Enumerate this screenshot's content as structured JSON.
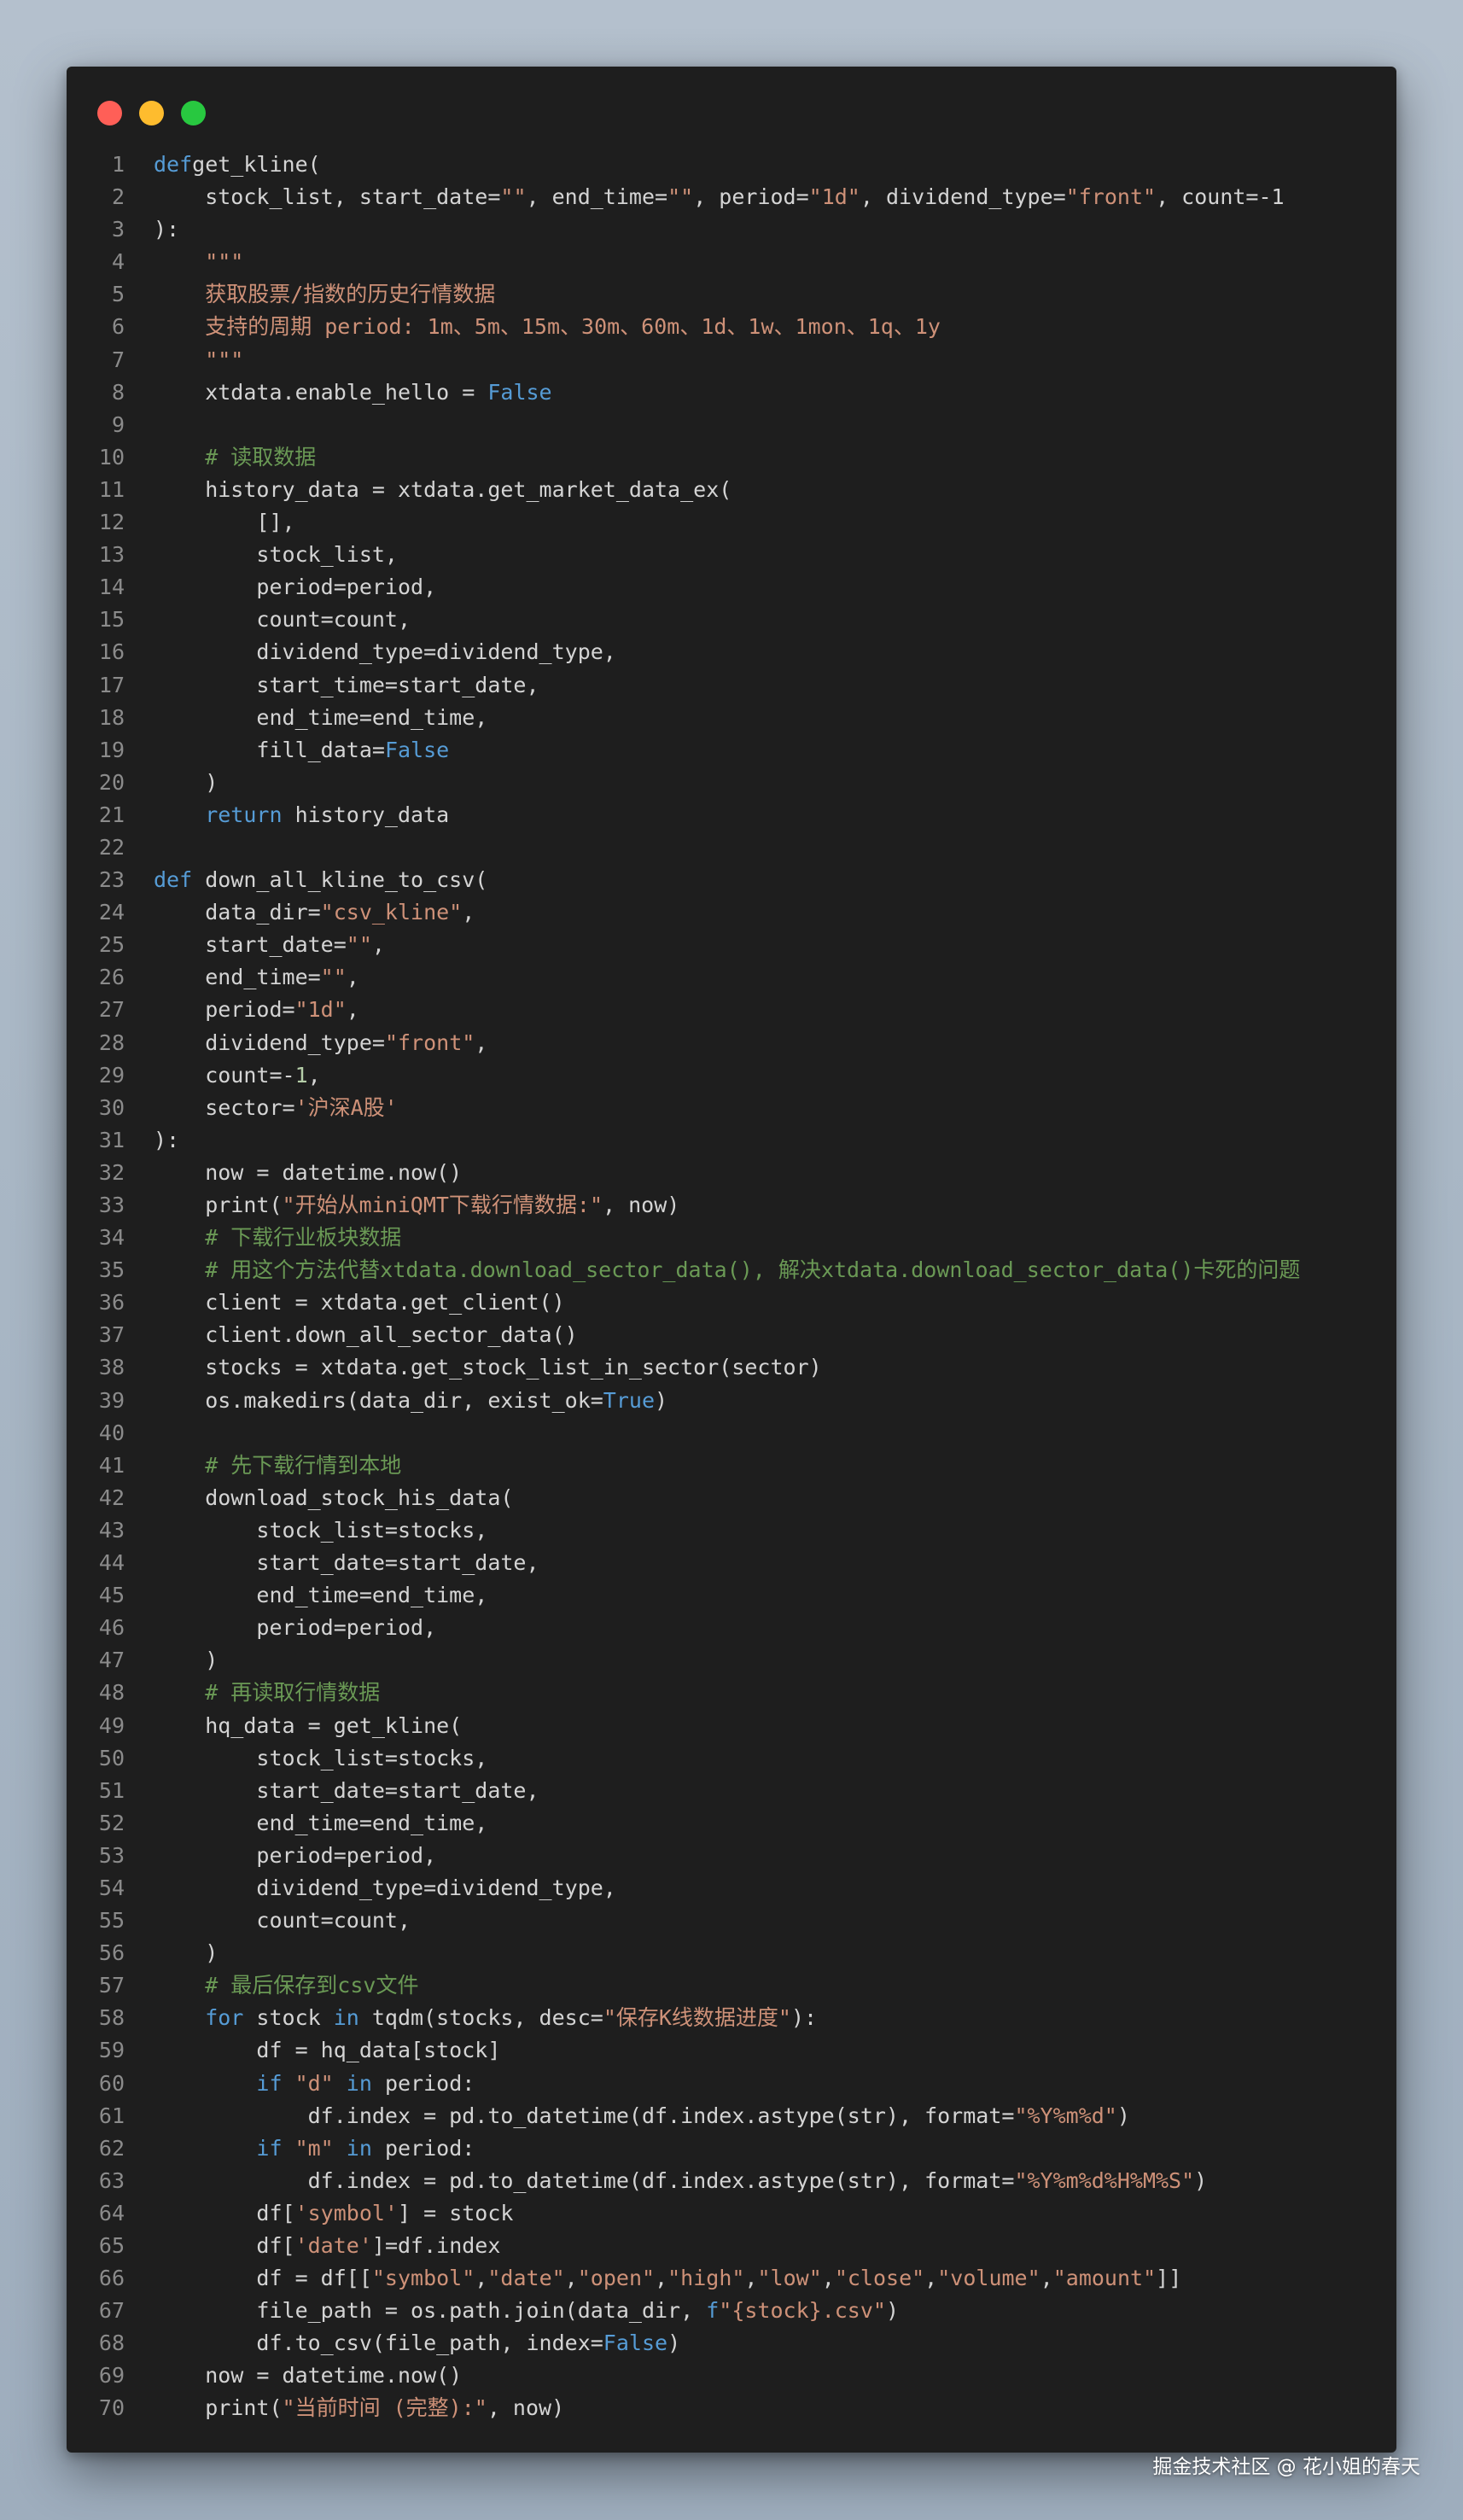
{
  "window": {
    "title_dots": [
      "close",
      "minimize",
      "zoom"
    ]
  },
  "colors": {
    "keyword": "#569cd6",
    "string": "#ce9178",
    "comment": "#6a9955",
    "number": "#b5cea8",
    "text": "#d4d4d4",
    "background": "#1e1e1e"
  },
  "code_lines": [
    [
      [
        "kw",
        "def"
      ],
      [
        "",
        "get_kline("
      ]
    ],
    [
      [
        "",
        "    stock_list, start_date="
      ],
      [
        "str",
        "\"\""
      ],
      [
        "",
        ", end_time="
      ],
      [
        "str",
        "\"\""
      ],
      [
        "",
        ", period="
      ],
      [
        "str",
        "\"1d\""
      ],
      [
        "",
        ", dividend_type="
      ],
      [
        "str",
        "\"front\""
      ],
      [
        "",
        ", count=-1"
      ]
    ],
    [
      [
        "",
        "):"
      ]
    ],
    [
      [
        "str",
        "    \"\"\""
      ]
    ],
    [
      [
        "str",
        "    获取股票/指数的历史行情数据"
      ]
    ],
    [
      [
        "str",
        "    支持的周期 period: 1m、5m、15m、30m、60m、1d、1w、1mon、1q、1y"
      ]
    ],
    [
      [
        "str",
        "    \"\"\""
      ]
    ],
    [
      [
        "",
        "    xtdata.enable_hello = "
      ],
      [
        "kw",
        "False"
      ]
    ],
    [
      [
        "",
        ""
      ]
    ],
    [
      [
        "cm",
        "    # 读取数据"
      ]
    ],
    [
      [
        "",
        "    history_data = xtdata.get_market_data_ex("
      ]
    ],
    [
      [
        "",
        "        [],"
      ]
    ],
    [
      [
        "",
        "        stock_list,"
      ]
    ],
    [
      [
        "",
        "        period=period,"
      ]
    ],
    [
      [
        "",
        "        count=count,"
      ]
    ],
    [
      [
        "",
        "        dividend_type=dividend_type,"
      ]
    ],
    [
      [
        "",
        "        start_time=start_date,"
      ]
    ],
    [
      [
        "",
        "        end_time=end_time,"
      ]
    ],
    [
      [
        "",
        "        fill_data="
      ],
      [
        "kw",
        "False"
      ]
    ],
    [
      [
        "",
        "    )"
      ]
    ],
    [
      [
        "kw",
        "    return"
      ],
      [
        "",
        " history_data"
      ]
    ],
    [
      [
        "",
        ""
      ]
    ],
    [
      [
        "kw",
        "def"
      ],
      [
        "",
        " down_all_kline_to_csv("
      ]
    ],
    [
      [
        "",
        "    data_dir="
      ],
      [
        "str",
        "\"csv_kline\""
      ],
      [
        "",
        ","
      ]
    ],
    [
      [
        "",
        "    start_date="
      ],
      [
        "str",
        "\"\""
      ],
      [
        "",
        ","
      ]
    ],
    [
      [
        "",
        "    end_time="
      ],
      [
        "str",
        "\"\""
      ],
      [
        "",
        ","
      ]
    ],
    [
      [
        "",
        "    period="
      ],
      [
        "str",
        "\"1d\""
      ],
      [
        "",
        ","
      ]
    ],
    [
      [
        "",
        "    dividend_type="
      ],
      [
        "str",
        "\"front\""
      ],
      [
        "",
        ","
      ]
    ],
    [
      [
        "",
        "    count=-"
      ],
      [
        "num",
        "1"
      ],
      [
        "",
        ","
      ]
    ],
    [
      [
        "",
        "    sector="
      ],
      [
        "str",
        "'沪深A股'"
      ]
    ],
    [
      [
        "",
        "):"
      ]
    ],
    [
      [
        "",
        "    now = datetime.now()"
      ]
    ],
    [
      [
        "",
        "    print("
      ],
      [
        "str",
        "\"开始从miniQMT下载行情数据:\""
      ],
      [
        "",
        ", now)"
      ]
    ],
    [
      [
        "cm",
        "    # 下载行业板块数据"
      ]
    ],
    [
      [
        "cm",
        "    # 用这个方法代替xtdata.download_sector_data(), 解决xtdata.download_sector_data()卡死的问题"
      ]
    ],
    [
      [
        "",
        "    client = xtdata.get_client()"
      ]
    ],
    [
      [
        "",
        "    client.down_all_sector_data()"
      ]
    ],
    [
      [
        "",
        "    stocks = xtdata.get_stock_list_in_sector(sector)"
      ]
    ],
    [
      [
        "",
        "    os.makedirs(data_dir, exist_ok="
      ],
      [
        "kw",
        "True"
      ],
      [
        "",
        ")"
      ]
    ],
    [
      [
        "",
        ""
      ]
    ],
    [
      [
        "cm",
        "    # 先下载行情到本地"
      ]
    ],
    [
      [
        "",
        "    download_stock_his_data("
      ]
    ],
    [
      [
        "",
        "        stock_list=stocks,"
      ]
    ],
    [
      [
        "",
        "        start_date=start_date,"
      ]
    ],
    [
      [
        "",
        "        end_time=end_time,"
      ]
    ],
    [
      [
        "",
        "        period=period,"
      ]
    ],
    [
      [
        "",
        "    )"
      ]
    ],
    [
      [
        "cm",
        "    # 再读取行情数据"
      ]
    ],
    [
      [
        "",
        "    hq_data = get_kline("
      ]
    ],
    [
      [
        "",
        "        stock_list=stocks,"
      ]
    ],
    [
      [
        "",
        "        start_date=start_date,"
      ]
    ],
    [
      [
        "",
        "        end_time=end_time,"
      ]
    ],
    [
      [
        "",
        "        period=period,"
      ]
    ],
    [
      [
        "",
        "        dividend_type=dividend_type,"
      ]
    ],
    [
      [
        "",
        "        count=count,"
      ]
    ],
    [
      [
        "",
        "    )"
      ]
    ],
    [
      [
        "cm",
        "    # 最后保存到csv文件"
      ]
    ],
    [
      [
        "kw",
        "    for"
      ],
      [
        "",
        " stock "
      ],
      [
        "kw",
        "in"
      ],
      [
        "",
        " tqdm(stocks, desc="
      ],
      [
        "str",
        "\"保存K线数据进度\""
      ],
      [
        "",
        "):"
      ]
    ],
    [
      [
        "",
        "        df = hq_data[stock]"
      ]
    ],
    [
      [
        "kw",
        "        if"
      ],
      [
        "",
        " "
      ],
      [
        "str",
        "\"d\""
      ],
      [
        "",
        " "
      ],
      [
        "kw",
        "in"
      ],
      [
        "",
        " period:"
      ]
    ],
    [
      [
        "",
        "            df.index = pd.to_datetime(df.index.astype(str), format="
      ],
      [
        "str",
        "\"%Y%m%d\""
      ],
      [
        "",
        ")"
      ]
    ],
    [
      [
        "kw",
        "        if"
      ],
      [
        "",
        " "
      ],
      [
        "str",
        "\"m\""
      ],
      [
        "",
        " "
      ],
      [
        "kw",
        "in"
      ],
      [
        "",
        " period:"
      ]
    ],
    [
      [
        "",
        "            df.index = pd.to_datetime(df.index.astype(str), format="
      ],
      [
        "str",
        "\"%Y%m%d%H%M%S\""
      ],
      [
        "",
        ")"
      ]
    ],
    [
      [
        "",
        "        df["
      ],
      [
        "str",
        "'symbol'"
      ],
      [
        "",
        "] = stock"
      ]
    ],
    [
      [
        "",
        "        df["
      ],
      [
        "str",
        "'date'"
      ],
      [
        "",
        "]=df.index"
      ]
    ],
    [
      [
        "",
        "        df = df[["
      ],
      [
        "str",
        "\"symbol\""
      ],
      [
        "",
        ","
      ],
      [
        "str",
        "\"date\""
      ],
      [
        "",
        ","
      ],
      [
        "str",
        "\"open\""
      ],
      [
        "",
        ","
      ],
      [
        "str",
        "\"high\""
      ],
      [
        "",
        ","
      ],
      [
        "str",
        "\"low\""
      ],
      [
        "",
        ","
      ],
      [
        "str",
        "\"close\""
      ],
      [
        "",
        ","
      ],
      [
        "str",
        "\"volume\""
      ],
      [
        "",
        ","
      ],
      [
        "str",
        "\"amount\""
      ],
      [
        "",
        "]]"
      ]
    ],
    [
      [
        "",
        "        file_path = os.path.join(data_dir, "
      ],
      [
        "kw",
        "f"
      ],
      [
        "str",
        "\"{stock}.csv\""
      ],
      [
        "",
        ")"
      ]
    ],
    [
      [
        "",
        "        df.to_csv(file_path, index="
      ],
      [
        "kw",
        "False"
      ],
      [
        "",
        ")"
      ]
    ],
    [
      [
        "",
        "    now = datetime.now()"
      ]
    ],
    [
      [
        "",
        "    print("
      ],
      [
        "str",
        "\"当前时间 (完整):\""
      ],
      [
        "",
        ", now)"
      ]
    ]
  ],
  "watermark": "掘金技术社区 @ 花小姐的春天"
}
